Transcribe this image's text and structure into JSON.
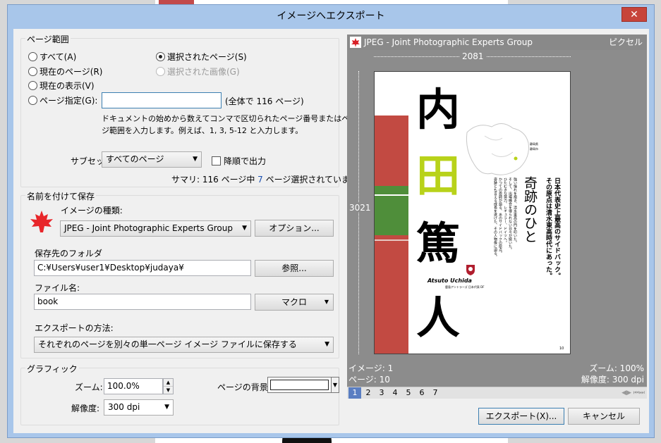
{
  "window": {
    "title": "イメージへエクスポート",
    "close_glyph": "✕"
  },
  "page_range": {
    "label": "ページ範囲",
    "all": "すべて(A)",
    "current_page": "現在のページ(R)",
    "current_view": "現在の表示(V)",
    "specify": "ページ指定(G):",
    "selected_pages": "選択されたページ(S)",
    "selected_image": "選択された画像(G)",
    "pages_value": "",
    "total_pages": "(全体で 116 ページ)",
    "help_line1": "ドキュメントの始めから数えてコンマで区切られたページ番号またはペー",
    "help_line2": "ジ範囲を入力します。例えば、1, 3, 5-12 と入力します。",
    "subset_label": "サブセット:",
    "subset_value": "すべてのページ",
    "reverse_label": "降順で出力",
    "summary_prefix": "サマリ: 116 ページ中 ",
    "summary_count": "7",
    "summary_suffix": " ページ選択されています"
  },
  "save_as": {
    "label": "名前を付けて保存",
    "type_label": "イメージの種類:",
    "type_value": "JPEG - Joint Photographic Experts Group",
    "options_button": "オプション...",
    "folder_label": "保存先のフォルダ",
    "folder_value": "C:¥Users¥user1¥Desktop¥judaya¥",
    "browse_button": "参照...",
    "filename_label": "ファイル名:",
    "filename_value": "book",
    "macro_button": "マクロ",
    "method_label": "エクスポートの方法:",
    "method_value": "それぞれのページを別々の単一ページ イメージ ファイルに保存する"
  },
  "graphics": {
    "label": "グラフィック",
    "zoom_label": "ズーム:",
    "zoom_value": "100.0%",
    "resolution_label": "解像度:",
    "resolution_value": "300 dpi",
    "background_label": "ページの背景:"
  },
  "preview": {
    "format": "JPEG - Joint Photographic Experts Group",
    "units": "ピクセル",
    "width_px": "2081",
    "height_px": "3021",
    "image_info": "イメージ: 1",
    "page_info": "ページ: 10",
    "zoom_info": "ズーム: 100%",
    "resolution_info": "解像度: 300 dpi",
    "pages": [
      "1",
      "2",
      "3",
      "4",
      "5",
      "6",
      "7"
    ],
    "content": {
      "title_chars": [
        "内",
        "田",
        "篤",
        "人"
      ],
      "heading": "奇跡のひと",
      "lead1": "日本代表史上最高のサイドバック。",
      "lead2": "その原点は清水東高時代にあった。",
      "body1": "強い憧れを抱き、清水東高の門を叩いた。",
      "body2": "そして、出場機会を得られない日々が続いた。",
      "body3": "ひたむきな努力、レギュラー、ドイツへ。",
      "body4": "かつての恩師が語る、あのサイドバックの原点。",
      "body5": "奇跡とも言える成長を遂げた、その人物像に迫る。",
      "map_label1": "静岡県",
      "map_label2": "静岡市",
      "name_latin": "Atsuto Uchida",
      "name_sub": "鹿島アントラーズ 日本代表 DF",
      "folio": "10"
    }
  },
  "colors": {
    "accent_green": "#b8d21a",
    "track_red": "#c24a42",
    "accent_blue": "#5a7ec2"
  },
  "actions": {
    "export_button": "エクスポート(X)...",
    "cancel_button": "キャンセル"
  },
  "icons": {
    "maple": "maple-leaf-icon",
    "dropdown": "chevron-down-icon"
  }
}
